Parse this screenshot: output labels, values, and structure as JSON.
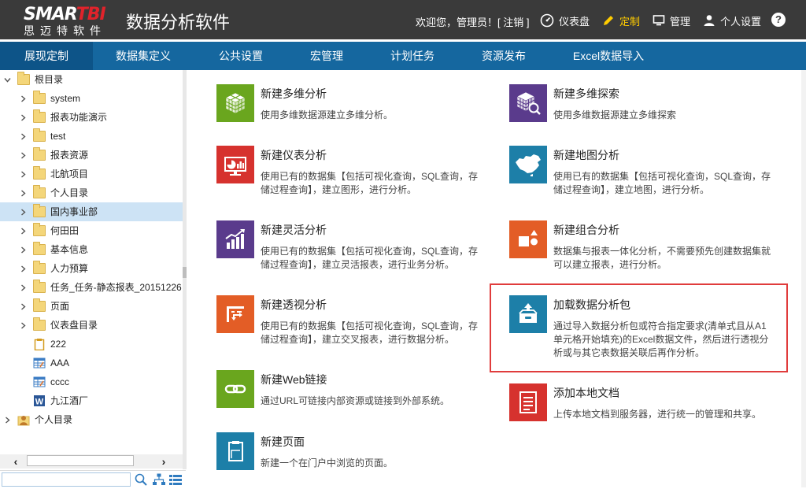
{
  "header": {
    "logo_prefix": "SMAR",
    "logo_suffix": "TBI",
    "logo_cn": "思迈特软件",
    "app_title": "数据分析软件",
    "welcome": "欢迎您，管理员！[ 注销 ]",
    "nav": {
      "dashboard": "仪表盘",
      "customize": "定制",
      "manage": "管理",
      "personal_settings": "个人设置"
    },
    "help": "?"
  },
  "menu": [
    "展现定制",
    "数据集定义",
    "公共设置",
    "宏管理",
    "计划任务",
    "资源发布",
    "Excel数据导入"
  ],
  "tree": [
    {
      "label": "根目录",
      "icon": "folder-icon"
    },
    {
      "label": "system",
      "icon": "folder-icon"
    },
    {
      "label": "报表功能演示",
      "icon": "folder-icon"
    },
    {
      "label": "test",
      "icon": "folder-icon"
    },
    {
      "label": "报表资源",
      "icon": "folder-icon"
    },
    {
      "label": "北航项目",
      "icon": "folder-icon"
    },
    {
      "label": "个人目录",
      "icon": "folder-icon"
    },
    {
      "label": "国内事业部",
      "icon": "folder-icon"
    },
    {
      "label": "何田田",
      "icon": "folder-icon"
    },
    {
      "label": "基本信息",
      "icon": "folder-icon"
    },
    {
      "label": "人力预算",
      "icon": "folder-icon"
    },
    {
      "label": "任务_任务-静态报表_20151226",
      "icon": "folder-icon"
    },
    {
      "label": "页面",
      "icon": "folder-icon"
    },
    {
      "label": "仪表盘目录",
      "icon": "folder-icon"
    },
    {
      "label": "222",
      "icon": "clipboard-icon"
    },
    {
      "label": "AAA",
      "icon": "table-report-icon"
    },
    {
      "label": "cccc",
      "icon": "table-report-icon"
    },
    {
      "label": "九江酒厂",
      "icon": "word-doc-icon"
    },
    {
      "label": "个人目录",
      "icon": "user-folder-icon"
    }
  ],
  "search": {
    "value": "",
    "placeholder": ""
  },
  "cards": {
    "olap": {
      "title": "新建多维分析",
      "desc": "使用多维数据源建立多维分析。"
    },
    "olap_explore": {
      "title": "新建多维探索",
      "desc": "使用多维数据源建立多维探索"
    },
    "dashboard": {
      "title": "新建仪表分析",
      "desc": "使用已有的数据集【包括可视化查询，SQL查询，存储过程查询】，建立图形，进行分析。"
    },
    "map": {
      "title": "新建地图分析",
      "desc": "使用已有的数据集【包括可视化查询，SQL查询，存储过程查询】，建立地图，进行分析。"
    },
    "flex": {
      "title": "新建灵活分析",
      "desc": "使用已有的数据集【包括可视化查询，SQL查询，存储过程查询】，建立灵活报表，进行业务分析。"
    },
    "combo": {
      "title": "新建组合分析",
      "desc": "数据集与报表一体化分析，不需要预先创建数据集就可以建立报表，进行分析。"
    },
    "pivot": {
      "title": "新建透视分析",
      "desc": "使用已有的数据集【包括可视化查询，SQL查询，存储过程查询】，建立交叉报表，进行数据分析。"
    },
    "load_package": {
      "title": "加载数据分析包",
      "desc": "通过导入数据分析包或符合指定要求(清单式且从A1单元格开始填充)的Excel数据文件，然后进行透视分析或与其它表数据关联后再作分析。"
    },
    "web_link": {
      "title": "新建Web链接",
      "desc": "通过URL可链接内部资源或链接到外部系统。"
    },
    "local_doc": {
      "title": "添加本地文档",
      "desc": "上传本地文档到服务器，进行统一的管理和共享。"
    },
    "page": {
      "title": "新建页面",
      "desc": "新建一个在门户中浏览的页面。"
    }
  },
  "colors": {
    "header_bg": "#3a3a3a",
    "menu_bg": "#15679f",
    "menu_active": "#0d5488",
    "green": "#6aa61e",
    "purple": "#5a3b8c",
    "red": "#d6322e",
    "teal": "#1d7fa8",
    "orange": "#e35d26",
    "highlight": "#e03c3c"
  }
}
